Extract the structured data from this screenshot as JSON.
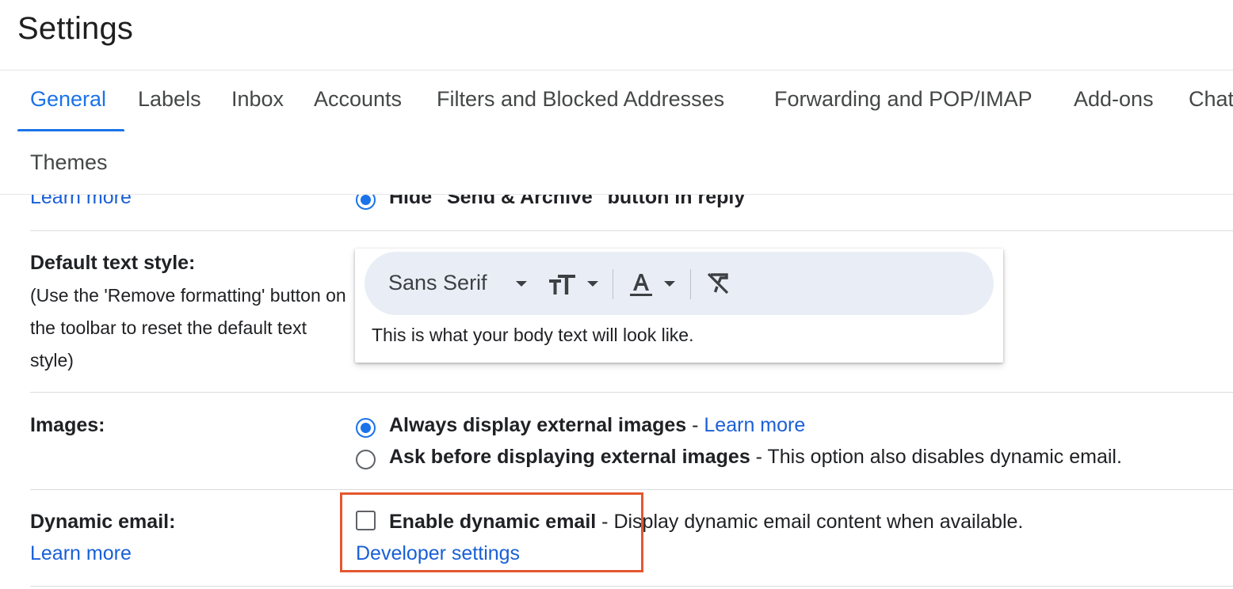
{
  "page": {
    "title": "Settings"
  },
  "tabs": [
    {
      "label": "General",
      "active": true
    },
    {
      "label": "Labels"
    },
    {
      "label": "Inbox"
    },
    {
      "label": "Accounts"
    },
    {
      "label": "Filters and Blocked Addresses"
    },
    {
      "label": "Forwarding and POP/IMAP"
    },
    {
      "label": "Add-ons"
    },
    {
      "label": "Chat"
    },
    {
      "label": "Themes"
    }
  ],
  "send_archive": {
    "learn_more": "Learn more",
    "option_label": "Hide \"Send & Archive\" button in reply",
    "selected": true
  },
  "text_style": {
    "label": "Default text style:",
    "hint": "(Use the 'Remove formatting' button on the toolbar to reset the default text style)",
    "font_name": "Sans Serif",
    "preview": "This is what your body text will look like."
  },
  "images": {
    "label": "Images:",
    "options": [
      {
        "label": "Always display external images",
        "sep": " - ",
        "link": "Learn more",
        "selected": true
      },
      {
        "label": "Ask before displaying external images",
        "sep": " - ",
        "description": "This option also disables dynamic email.",
        "selected": false
      }
    ]
  },
  "dynamic_email": {
    "label": "Dynamic email:",
    "learn_more": "Learn more",
    "checkbox_label": "Enable dynamic email",
    "sep": " - ",
    "description": "Display dynamic email content when available.",
    "developer_link": "Developer settings",
    "checked": false
  },
  "colors": {
    "accent": "#1a73e8",
    "link": "#1a5fd6",
    "highlight": "#e4572e",
    "toolbar_bg": "#e9eef6"
  }
}
